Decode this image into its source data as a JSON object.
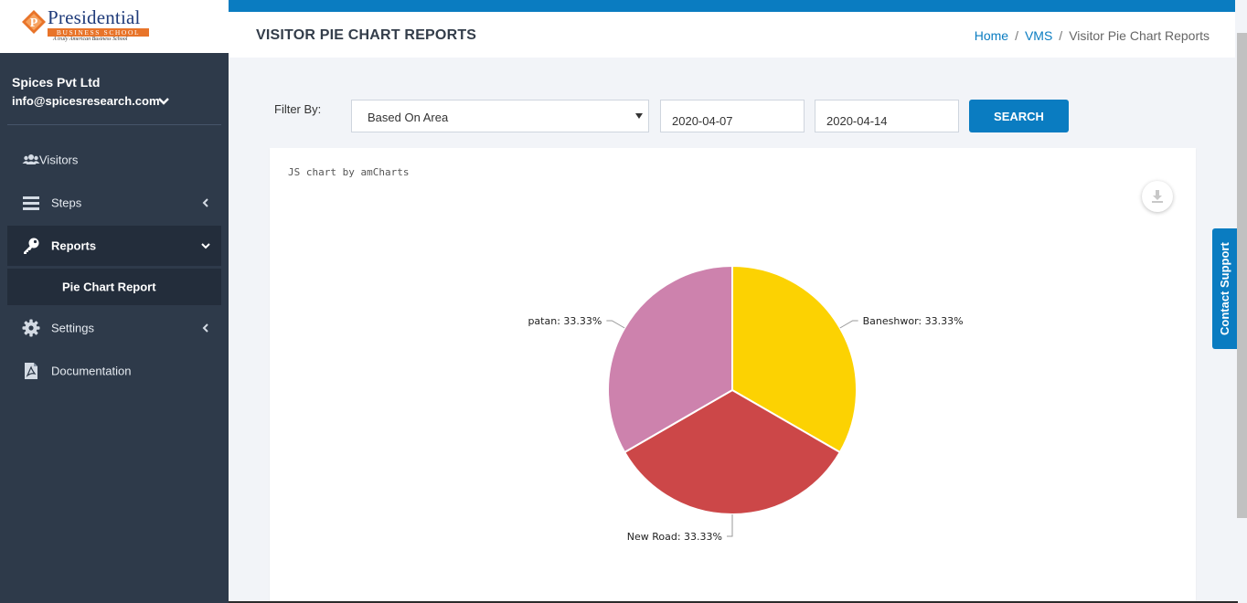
{
  "brand": {
    "title": "Presidential",
    "subtitle": "BUSINESS SCHOOL",
    "tagline": "A truly American Business School",
    "emblem_letter": "P",
    "colors": {
      "navy": "#1f3b7a",
      "orange": "#e8742a"
    }
  },
  "user": {
    "company": "Spices Pvt Ltd",
    "email": "info@spicesresearch.com"
  },
  "sidebar": {
    "items": [
      {
        "label": "Visitors",
        "icon": "users-icon"
      },
      {
        "label": "Steps",
        "icon": "bars-icon",
        "chevron": "left"
      },
      {
        "label": "Reports",
        "icon": "key-icon",
        "chevron": "down",
        "active": true
      },
      {
        "label": "Settings",
        "icon": "gear-icon",
        "chevron": "left"
      },
      {
        "label": "Documentation",
        "icon": "pdf-file-icon"
      }
    ],
    "subitem": {
      "label": "Pie Chart Report",
      "active": true
    }
  },
  "header": {
    "title": "VISITOR PIE CHART REPORTS",
    "breadcrumb": [
      "Home",
      "VMS",
      "Visitor Pie Chart Reports"
    ]
  },
  "filter": {
    "label": "Filter By:",
    "select_value": "Based On Area",
    "start_date": "2020-04-07",
    "end_date": "2020-04-14",
    "search_label": "SEARCH"
  },
  "chart_panel": {
    "credit": "JS chart by amCharts",
    "download_icon": "download-icon"
  },
  "chart_data": {
    "type": "pie",
    "title": "",
    "slices": [
      {
        "label": "Baneshwor",
        "value": 33.33,
        "display": "Baneshwor: 33.33%",
        "color": "#fcd202"
      },
      {
        "label": "New Road",
        "value": 33.33,
        "display": "New Road: 33.33%",
        "color": "#cc4748"
      },
      {
        "label": "patan",
        "value": 33.33,
        "display": "patan: 33.33%",
        "color": "#cd82ad"
      }
    ]
  },
  "support_tab": {
    "label": "Contact Support"
  },
  "colors": {
    "sidebar_bg": "#2e3a4a",
    "sidebar_active": "#232d3b",
    "accent": "#0a7cc1",
    "page_bg": "#f2f4f8"
  }
}
